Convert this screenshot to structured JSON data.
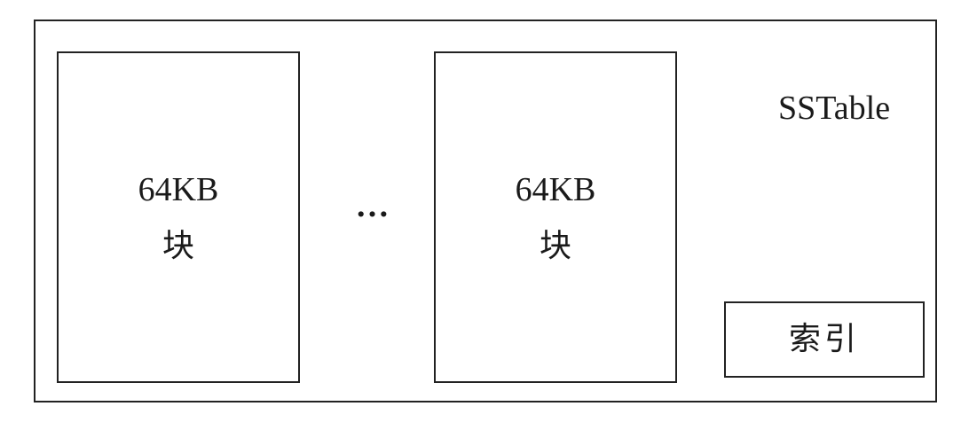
{
  "diagram": {
    "container_label": "SSTable",
    "blocks": [
      {
        "size": "64KB",
        "unit": "块"
      },
      {
        "size": "64KB",
        "unit": "块"
      }
    ],
    "ellipsis": "…",
    "index_label": "索引"
  }
}
